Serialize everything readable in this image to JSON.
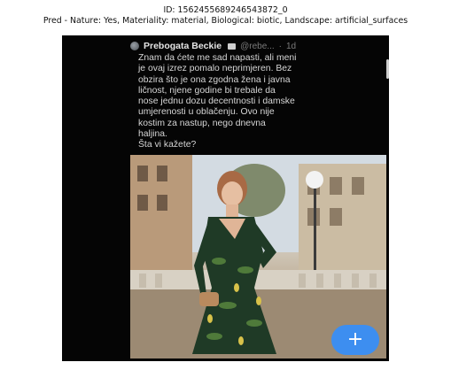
{
  "header": {
    "id_line": "ID: 1562455689246543872_0",
    "pred_line": "Pred - Nature: Yes, Materiality: material, Biological: biotic, Landscape: artificial_surfaces"
  },
  "tweet": {
    "display_name": "Prebogata Beckie",
    "handle": "@rebe...",
    "separator": "·",
    "time": "1d",
    "text": "Znam da ćete me sad napasti, ali meni\nje ovaj izrez pomalo neprimjeren. Bez\nobzira što je ona zgodna žena i javna\nličnost, njene godine bi trebale da\nnose jednu dozu decentnosti i damske\numjerenosti u oblačenju. Ovo nije\nkostim za nastup, nego dnevna\nhaljina.\nŠta vi kažete?"
  },
  "fab": {
    "icon": "plus-icon",
    "label": "+"
  },
  "colors": {
    "phone_bg": "#050505",
    "fab_bg": "#3d8ef0",
    "tweet_text": "#d6d6d6"
  }
}
